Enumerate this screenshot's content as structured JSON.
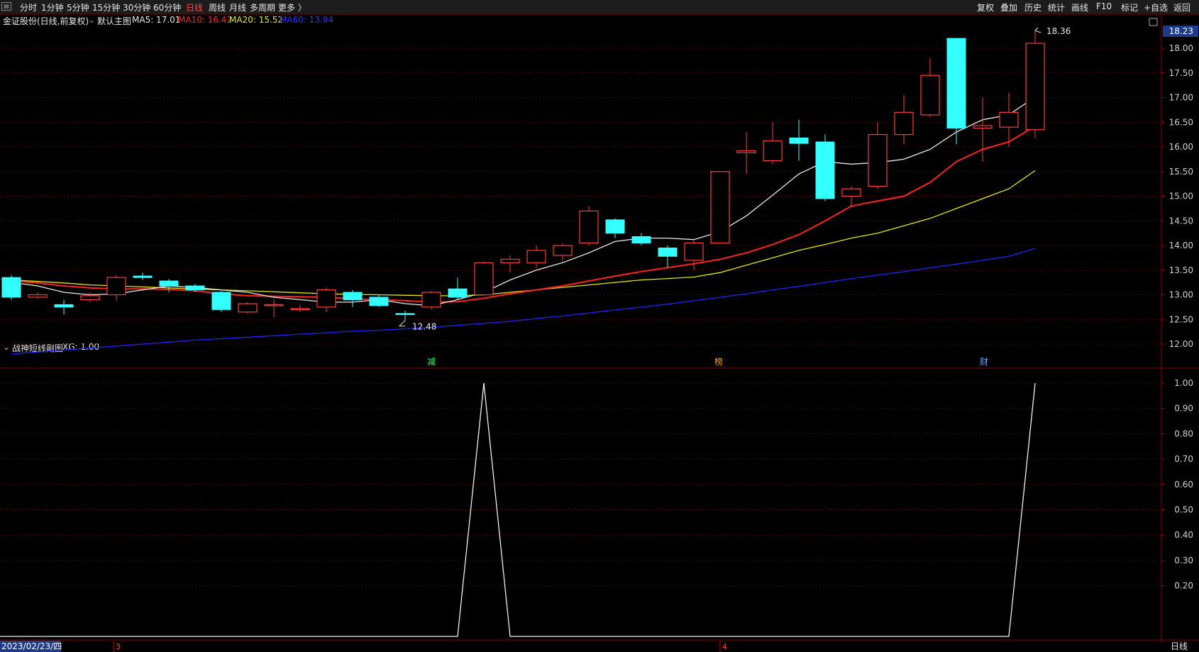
{
  "toolbar": {
    "left": [
      "分时",
      "1分钟",
      "5分钟",
      "15分钟",
      "30分钟",
      "60分钟",
      "日线",
      "周线",
      "月线",
      "多周期",
      "更多 〉"
    ],
    "active": "日线",
    "right": [
      "复权",
      "叠加",
      "历史",
      "统计",
      "画线",
      "F10",
      "标记",
      "+自选",
      "返回"
    ]
  },
  "main": {
    "stock_title": "金证股份(日线,前复权)",
    "chart_name": "默认主图",
    "ma5_label": "MA5: 17.01",
    "ma10_label": "MA10: 16.42",
    "ma20_label": "MA20: 15.52",
    "ma60_label": "MA60: 13.94",
    "current_price": "18.23",
    "high_label": "18.36",
    "low_label": "12.48",
    "markers": [
      "减",
      "榜",
      "财"
    ]
  },
  "sub": {
    "name": "战神短线副图",
    "xg_label": "XG: 1.00"
  },
  "axis": {
    "date_label": "2023/02/23/四",
    "month_marks": [
      "3",
      "4"
    ],
    "period_label": "日线"
  },
  "colors": {
    "up": "#ff3b3b",
    "down": "#33ffff",
    "ma5": "#e8e8e8",
    "ma10": "#ff2020",
    "ma20": "#e8e800",
    "ma60": "#2020ff",
    "grid": "#5a0000"
  },
  "chart_data": {
    "type": "candlestick",
    "ylim_main": [
      11.8,
      18.45
    ],
    "yticks_main": [
      12.0,
      12.5,
      13.0,
      13.5,
      14.0,
      14.5,
      15.0,
      15.5,
      16.0,
      16.5,
      17.0,
      17.5,
      18.0
    ],
    "candles": [
      {
        "o": 13.35,
        "c": 12.95,
        "h": 13.4,
        "l": 12.9
      },
      {
        "o": 12.95,
        "c": 13.0,
        "h": 13.05,
        "l": 12.92
      },
      {
        "o": 12.8,
        "c": 12.75,
        "h": 12.9,
        "l": 12.6
      },
      {
        "o": 12.9,
        "c": 12.98,
        "h": 13.05,
        "l": 12.85
      },
      {
        "o": 13.0,
        "c": 13.35,
        "h": 13.4,
        "l": 12.88
      },
      {
        "o": 13.38,
        "c": 13.35,
        "h": 13.45,
        "l": 13.3
      },
      {
        "o": 13.28,
        "c": 13.18,
        "h": 13.32,
        "l": 13.05
      },
      {
        "o": 13.18,
        "c": 13.1,
        "h": 13.22,
        "l": 13.05
      },
      {
        "o": 13.05,
        "c": 12.7,
        "h": 13.08,
        "l": 12.65
      },
      {
        "o": 12.65,
        "c": 12.82,
        "h": 12.85,
        "l": 12.62
      },
      {
        "o": 12.8,
        "c": 12.8,
        "h": 12.9,
        "l": 12.55
      },
      {
        "o": 12.7,
        "c": 12.72,
        "h": 12.8,
        "l": 12.65
      },
      {
        "o": 12.75,
        "c": 13.1,
        "h": 13.15,
        "l": 12.65
      },
      {
        "o": 13.05,
        "c": 12.9,
        "h": 13.1,
        "l": 12.75
      },
      {
        "o": 12.95,
        "c": 12.78,
        "h": 13.0,
        "l": 12.75
      },
      {
        "o": 12.62,
        "c": 12.6,
        "h": 12.68,
        "l": 12.48
      },
      {
        "o": 12.75,
        "c": 13.05,
        "h": 13.08,
        "l": 12.7
      },
      {
        "o": 13.12,
        "c": 12.95,
        "h": 13.35,
        "l": 12.9
      },
      {
        "o": 13.0,
        "c": 13.65,
        "h": 13.68,
        "l": 12.98
      },
      {
        "o": 13.65,
        "c": 13.72,
        "h": 13.8,
        "l": 13.45
      },
      {
        "o": 13.65,
        "c": 13.9,
        "h": 14.0,
        "l": 13.55
      },
      {
        "o": 13.8,
        "c": 14.0,
        "h": 14.05,
        "l": 13.7
      },
      {
        "o": 14.05,
        "c": 14.7,
        "h": 14.8,
        "l": 14.0
      },
      {
        "o": 14.52,
        "c": 14.25,
        "h": 14.55,
        "l": 14.15
      },
      {
        "o": 14.18,
        "c": 14.05,
        "h": 14.25,
        "l": 14.0
      },
      {
        "o": 13.95,
        "c": 13.78,
        "h": 14.0,
        "l": 13.55
      },
      {
        "o": 13.7,
        "c": 14.05,
        "h": 14.1,
        "l": 13.5
      },
      {
        "o": 14.05,
        "c": 15.5,
        "h": 15.5,
        "l": 14.05
      },
      {
        "o": 15.88,
        "c": 15.92,
        "h": 16.3,
        "l": 15.45
      },
      {
        "o": 15.72,
        "c": 16.12,
        "h": 16.5,
        "l": 15.65
      },
      {
        "o": 16.18,
        "c": 16.07,
        "h": 16.55,
        "l": 15.72
      },
      {
        "o": 16.1,
        "c": 14.95,
        "h": 16.25,
        "l": 14.9
      },
      {
        "o": 15.0,
        "c": 15.15,
        "h": 15.2,
        "l": 14.78
      },
      {
        "o": 15.2,
        "c": 16.25,
        "h": 16.5,
        "l": 15.15
      },
      {
        "o": 16.25,
        "c": 16.7,
        "h": 17.05,
        "l": 16.05
      },
      {
        "o": 16.65,
        "c": 17.45,
        "h": 17.8,
        "l": 16.6
      },
      {
        "o": 18.2,
        "c": 16.38,
        "h": 18.2,
        "l": 16.05
      },
      {
        "o": 16.38,
        "c": 16.43,
        "h": 17.0,
        "l": 15.7
      },
      {
        "o": 16.4,
        "c": 16.7,
        "h": 17.1,
        "l": 16.0
      },
      {
        "o": 16.35,
        "c": 18.1,
        "h": 18.36,
        "l": 16.18
      }
    ],
    "ma5": [
      13.25,
      13.18,
      13.05,
      13.0,
      13.02,
      13.1,
      13.18,
      13.15,
      13.1,
      13.05,
      12.95,
      12.9,
      12.85,
      12.85,
      12.9,
      12.82,
      12.78,
      12.9,
      13.05,
      13.3,
      13.5,
      13.65,
      13.85,
      14.08,
      14.15,
      14.15,
      14.12,
      14.28,
      14.6,
      15.02,
      15.45,
      15.7,
      15.65,
      15.68,
      15.75,
      15.95,
      16.3,
      16.55,
      16.65,
      17.01
    ],
    "ma10": [
      13.28,
      13.24,
      13.18,
      13.14,
      13.12,
      13.12,
      13.11,
      13.08,
      13.02,
      12.98,
      12.97,
      12.96,
      12.95,
      12.92,
      12.9,
      12.88,
      12.85,
      12.86,
      12.93,
      13.02,
      13.1,
      13.18,
      13.28,
      13.38,
      13.47,
      13.55,
      13.63,
      13.72,
      13.85,
      14.02,
      14.22,
      14.5,
      14.8,
      14.9,
      15.0,
      15.28,
      15.7,
      15.95,
      16.1,
      16.42
    ],
    "ma20": [
      13.3,
      13.27,
      13.24,
      13.2,
      13.18,
      13.16,
      13.14,
      13.12,
      13.1,
      13.08,
      13.06,
      13.04,
      13.02,
      13.01,
      13.0,
      12.99,
      12.98,
      12.98,
      13.0,
      13.05,
      13.1,
      13.15,
      13.2,
      13.25,
      13.3,
      13.33,
      13.36,
      13.45,
      13.6,
      13.75,
      13.9,
      14.02,
      14.15,
      14.25,
      14.4,
      14.55,
      14.75,
      14.95,
      15.15,
      15.52
    ],
    "ma60": [
      11.8,
      11.84,
      11.88,
      11.92,
      11.96,
      12.0,
      12.04,
      12.08,
      12.11,
      12.14,
      12.17,
      12.2,
      12.23,
      12.26,
      12.28,
      12.31,
      12.34,
      12.38,
      12.42,
      12.46,
      12.52,
      12.57,
      12.63,
      12.69,
      12.75,
      12.81,
      12.88,
      12.95,
      13.02,
      13.1,
      13.17,
      13.25,
      13.33,
      13.4,
      13.47,
      13.55,
      13.62,
      13.7,
      13.78,
      13.94
    ],
    "sub": {
      "name": "XG",
      "ylim": [
        0,
        1.0
      ],
      "yticks": [
        0.2,
        0.3,
        0.4,
        0.5,
        0.6,
        0.7,
        0.8,
        0.9,
        1.0
      ],
      "values": [
        0,
        0,
        0,
        0,
        0,
        0,
        0,
        0,
        0,
        0,
        0,
        0,
        0,
        0,
        0,
        0,
        0,
        0,
        1,
        0,
        0,
        0,
        0,
        0,
        0,
        0,
        0,
        0,
        0,
        0,
        0,
        0,
        0,
        0,
        0,
        0,
        0,
        0,
        0,
        1
      ]
    }
  }
}
